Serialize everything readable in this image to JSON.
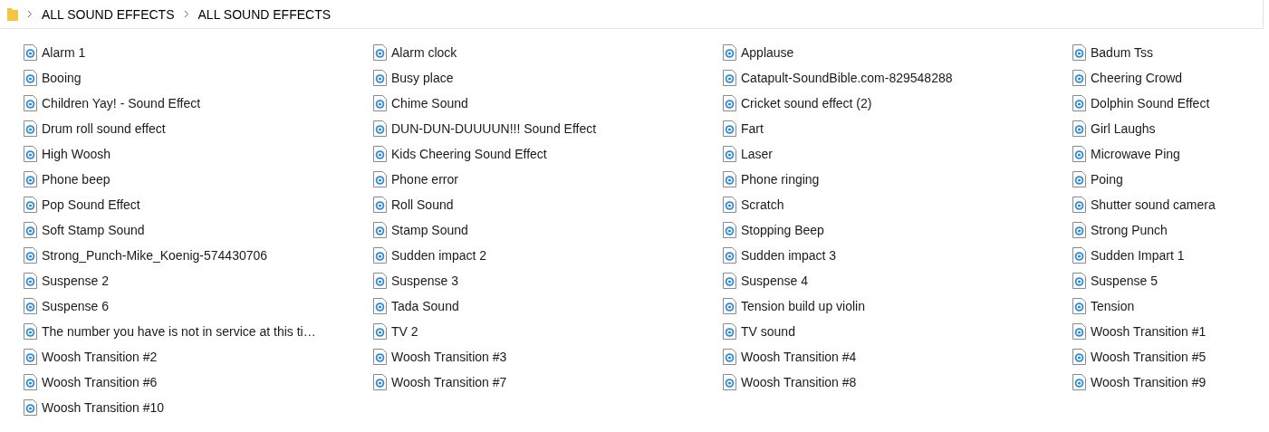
{
  "breadcrumb": [
    "ALL SOUND EFFECTS",
    "ALL SOUND EFFECTS"
  ],
  "files": [
    "Alarm 1",
    "Alarm clock",
    "Applause",
    "Badum Tss",
    "Booing",
    "Busy place",
    "Catapult-SoundBible.com-829548288",
    "Cheering Crowd",
    "Children Yay! - Sound Effect",
    "Chime Sound",
    "Cricket sound effect (2)",
    "Dolphin Sound Effect",
    "Drum roll sound effect",
    "DUN-DUN-DUUUUN!!! Sound Effect",
    "Fart",
    "Girl Laughs",
    "High Woosh",
    "Kids Cheering Sound Effect",
    "Laser",
    "Microwave Ping",
    "Phone beep",
    "Phone error",
    "Phone ringing",
    "Poing",
    "Pop Sound Effect",
    "Roll Sound",
    "Scratch",
    "Shutter sound camera",
    "Soft Stamp Sound",
    "Stamp Sound",
    "Stopping Beep",
    "Strong Punch",
    "Strong_Punch-Mike_Koenig-574430706",
    "Sudden impact 2",
    "Sudden impact 3",
    "Sudden Impart 1",
    "Suspense 2",
    "Suspense 3",
    "Suspense 4",
    "Suspense 5",
    "Suspense 6",
    "Tada Sound",
    "Tension build up violin",
    "Tension",
    "The number you have is not in service at this ti…",
    "TV 2",
    "TV sound",
    "Woosh Transition #1",
    "Woosh Transition #2",
    "Woosh Transition #3",
    "Woosh Transition #4",
    "Woosh Transition #5",
    "Woosh Transition #6",
    "Woosh Transition #7",
    "Woosh Transition #8",
    "Woosh Transition #9",
    "Woosh Transition #10"
  ]
}
